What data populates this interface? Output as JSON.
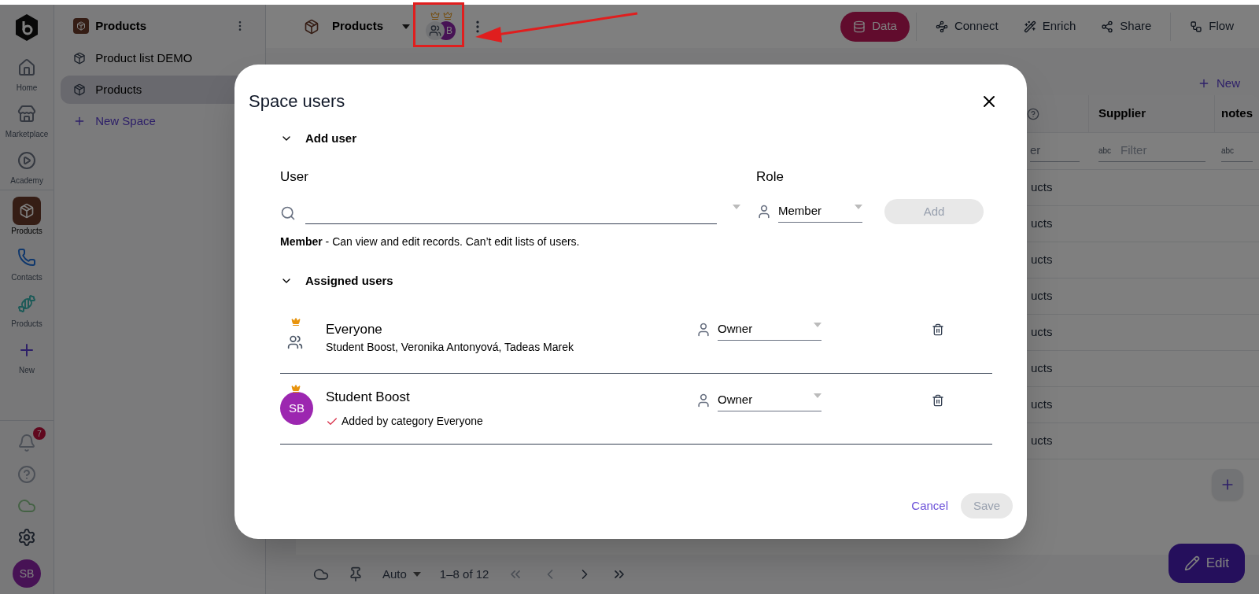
{
  "rail": {
    "items": [
      {
        "label": "Home",
        "kind": "home",
        "selected": false
      },
      {
        "label": "Marketplace",
        "kind": "store",
        "selected": false
      },
      {
        "label": "Academy",
        "kind": "play",
        "selected": false
      },
      {
        "label": "Products",
        "kind": "box",
        "selected": true
      },
      {
        "label": "Contacts",
        "kind": "phone",
        "selected": false
      },
      {
        "label": "Products",
        "kind": "candy",
        "selected": false
      },
      {
        "label": "New",
        "kind": "new",
        "selected": false
      }
    ],
    "notifications": "7",
    "avatar": "SB"
  },
  "sidebar": {
    "title": "Products",
    "items": [
      {
        "label": "Product list DEMO",
        "selected": false
      },
      {
        "label": "Products",
        "selected": true
      }
    ],
    "new_space": "New Space"
  },
  "topbar": {
    "title": "Products",
    "avatar": "B",
    "tools": [
      {
        "label": "Data",
        "kind": "database",
        "selected": true
      },
      {
        "label": "Connect",
        "kind": "connect",
        "selected": false
      },
      {
        "label": "Enrich",
        "kind": "wand",
        "selected": false
      },
      {
        "label": "Share",
        "kind": "share",
        "selected": false
      },
      {
        "label": "Flow",
        "kind": "flow",
        "selected": false
      }
    ]
  },
  "table": {
    "new_button": "New",
    "columns": [
      {
        "filter": "er"
      },
      {
        "label": "Supplier",
        "filter": "Filter",
        "type_badge": "abc"
      },
      {
        "label": "notes",
        "type_badge": "abc"
      }
    ],
    "rows": [
      "ucts",
      "ucts",
      "ucts",
      "ucts",
      "ucts",
      "ucts",
      "ucts",
      "ucts"
    ],
    "pager": {
      "mode": "Auto",
      "range": "1–8 of 12"
    },
    "edit_button": "Edit"
  },
  "modal": {
    "title": "Space users",
    "add_section": {
      "heading": "Add user",
      "expanded": true,
      "user_label": "User",
      "role_label": "Role",
      "role": "Member",
      "add_button": "Add",
      "add_disabled": true,
      "hint": "**Member** - Can view and edit records. Can’t edit lists of users."
    },
    "assigned_section": {
      "heading": "Assigned users",
      "expanded": true,
      "users": [
        {
          "kind": "group",
          "name": "Everyone",
          "detail": "Student Boost, Veronika Antonyová, Tadeas Marek",
          "owner": true,
          "role": "Owner",
          "added_by_category": false
        },
        {
          "kind": "person",
          "initials": "SB",
          "name": "Student Boost",
          "detail": "Added by category Everyone",
          "owner": true,
          "role": "Owner",
          "added_by_category": true
        }
      ]
    },
    "cancel": "Cancel",
    "save": "Save",
    "save_disabled": true
  }
}
